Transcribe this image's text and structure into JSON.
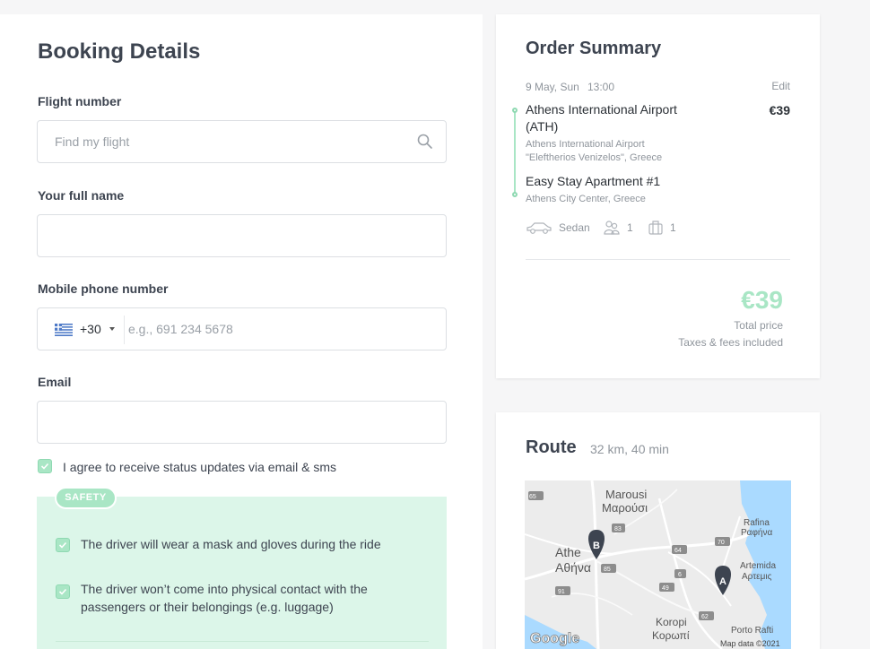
{
  "booking": {
    "title": "Booking Details",
    "flight_label": "Flight number",
    "flight_placeholder": "Find my flight",
    "name_label": "Your full name",
    "phone_label": "Mobile phone number",
    "phone_code": "+30",
    "phone_placeholder": "e.g., 691 234 5678",
    "email_label": "Email",
    "agree_text": "I agree to receive status updates via email & sms",
    "safety_badge": "SAFETY",
    "safety_items": [
      "The driver will wear a mask and gloves during the ride",
      "The driver won’t come into physical contact with the",
      "passengers or their belongings (e.g. luggage)"
    ]
  },
  "summary": {
    "title": "Order Summary",
    "date": "9 May, Sun",
    "time": "13:00",
    "edit": "Edit",
    "from_name_1": "Athens International Airport",
    "from_name_2": "(ATH)",
    "from_sub_1": "Athens International Airport",
    "from_sub_2": "\"Eleftherios Venizelos\", Greece",
    "to_name": "Easy Stay Apartment #1",
    "to_sub": "Athens City Center, Greece",
    "price": "€39",
    "vehicle": "Sedan",
    "passengers": "1",
    "luggage": "1",
    "total_price": "€39",
    "total_label": "Total price",
    "taxes_label": "Taxes & fees included"
  },
  "route": {
    "title": "Route",
    "info": "32 km, 40 min",
    "map": {
      "marker_a": "A",
      "marker_b": "B",
      "places": [
        "Marousi",
        "Μαρούσι",
        "Athe",
        "Αθήνα",
        "Rafina",
        "Ραφήνα",
        "Artemida",
        "Αρτεμις",
        "Koropi",
        "Κορωπί",
        "Porto Rafti"
      ],
      "roads": [
        "65",
        "83",
        "64",
        "70",
        "6",
        "49",
        "91",
        "62",
        "85"
      ],
      "brand": "Google",
      "attribution": "Map data ©2021"
    }
  },
  "colors": {
    "accent": "#a9e6c5",
    "safety_bg": "#dcf6e9",
    "text": "#3d4450",
    "muted": "#8f959c"
  }
}
